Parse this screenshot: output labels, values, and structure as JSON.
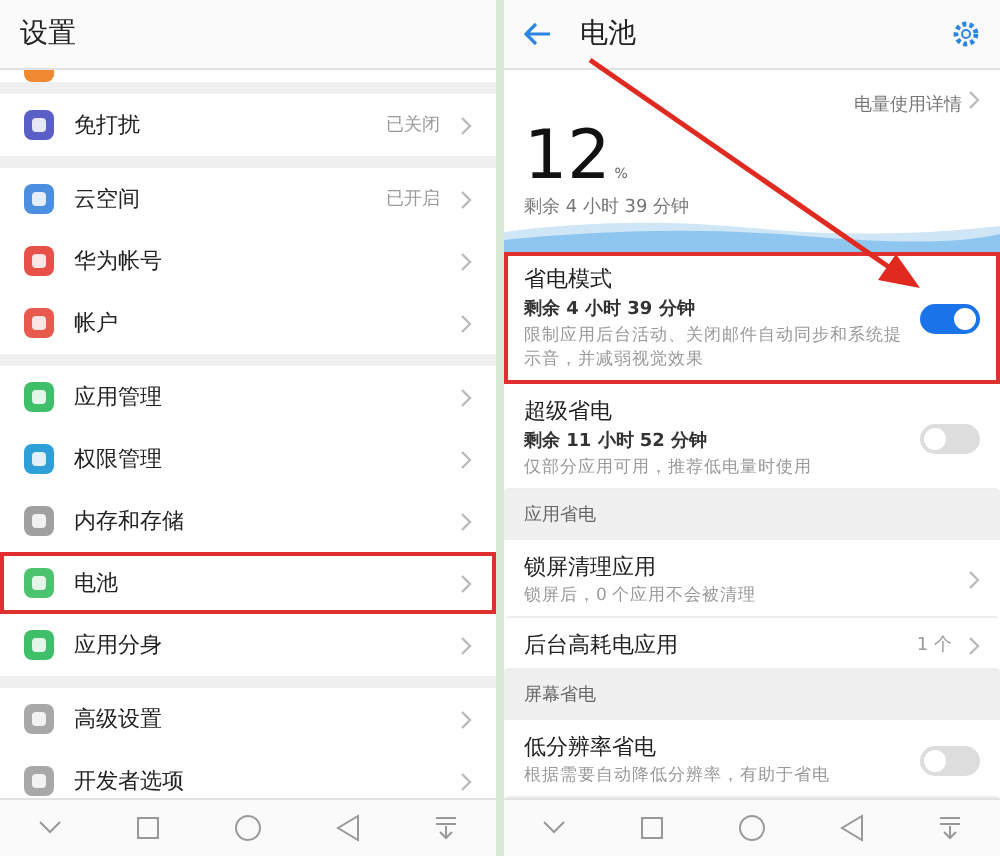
{
  "settings": {
    "title": "设置",
    "groups": [
      [
        {
          "label": "免打扰",
          "value": "已关闭",
          "color": "#5a5fc8",
          "highlighted": false
        }
      ],
      [
        {
          "label": "云空间",
          "value": "已开启",
          "color": "#4a8fe0",
          "highlighted": false
        },
        {
          "label": "华为帐号",
          "color": "#e8504a",
          "highlighted": false
        },
        {
          "label": "帐户",
          "color": "#e85a4e",
          "highlighted": false
        }
      ],
      [
        {
          "label": "应用管理",
          "color": "#3fbf6a",
          "highlighted": false
        },
        {
          "label": "权限管理",
          "color": "#2f9fd8",
          "highlighted": false
        },
        {
          "label": "内存和存储",
          "color": "#a0a0a0",
          "highlighted": false
        },
        {
          "label": "电池",
          "color": "#4cc36e",
          "highlighted": true
        },
        {
          "label": "应用分身",
          "color": "#3fbf6a",
          "highlighted": false
        }
      ],
      [
        {
          "label": "高级设置",
          "color": "#a8a8a8",
          "highlighted": false
        },
        {
          "label": "开发者选项",
          "color": "#a8a8a8",
          "highlighted": false
        }
      ]
    ]
  },
  "battery": {
    "title": "电池",
    "detail_link": "电量使用详情",
    "percent": "12",
    "percent_sign": "%",
    "remaining": "剩余 4 小时 39 分钟",
    "rows": [
      {
        "kind": "toggle",
        "title": "省电模式",
        "subtitle": "剩余 4 小时 39 分钟",
        "description": "限制应用后台活动、关闭邮件自动同步和系统提示音，并减弱视觉效果",
        "on": true,
        "highlighted": true
      },
      {
        "kind": "toggle",
        "title": "超级省电",
        "subtitle": "剩余 11 小时 52 分钟",
        "description": "仅部分应用可用，推荐低电量时使用",
        "on": false,
        "highlighted": false
      },
      {
        "kind": "section",
        "title": "应用省电"
      },
      {
        "kind": "link",
        "title": "锁屏清理应用",
        "description": "锁屏后，0 个应用不会被清理",
        "highlighted": false
      },
      {
        "kind": "link",
        "title": "后台高耗电应用",
        "value": "1 个",
        "highlighted": false
      },
      {
        "kind": "section",
        "title": "屏幕省电"
      },
      {
        "kind": "toggle",
        "title": "低分辨率省电",
        "description": "根据需要自动降低分辨率，有助于省电",
        "on": false,
        "highlighted": false
      }
    ]
  }
}
